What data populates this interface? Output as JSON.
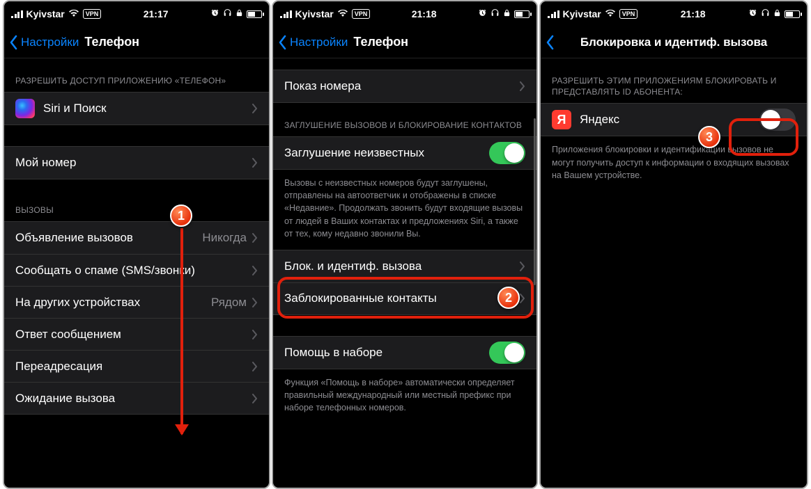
{
  "status": {
    "carrier": "Kyivstar",
    "vpn": "VPN",
    "times": {
      "s1": "21:17",
      "s2": "21:18",
      "s3": "21:18"
    }
  },
  "s1": {
    "back": "Настройки",
    "title": "Телефон",
    "sec_allow": "РАЗРЕШИТЬ ДОСТУП ПРИЛОЖЕНИЮ «ТЕЛЕФОН»",
    "siri": "Siri и Поиск",
    "my_number": "Мой номер",
    "sec_calls": "ВЫЗОВЫ",
    "announce": "Объявление вызовов",
    "announce_v": "Никогда",
    "spam": "Сообщать о спаме (SMS/звонки)",
    "other_dev": "На других устройствах",
    "other_dev_v": "Рядом",
    "reply_msg": "Ответ сообщением",
    "forward": "Переадресация",
    "waiting": "Ожидание вызова"
  },
  "s2": {
    "back": "Настройки",
    "title": "Телефон",
    "show_id": "Показ номера",
    "sec_sil": "ЗАГЛУШЕНИЕ ВЫЗОВОВ И БЛОКИРОВАНИЕ КОНТАКТОВ",
    "silence": "Заглушение неизвестных",
    "silence_foot": "Вызовы с неизвестных номеров будут заглушены, отправлены на автоответчик и отображены в списке «Недавние». Продолжать звонить будут входящие вызовы от людей в Ваших контактах и предложениях Siri, а также от тех, кому недавно звонили Вы.",
    "block_id": "Блок. и идентиф. вызова",
    "blocked": "Заблокированные контакты",
    "assist": "Помощь в наборе",
    "assist_foot": "Функция «Помощь в наборе» автоматически определяет правильный международный или местный префикс при наборе телефонных номеров."
  },
  "s3": {
    "title": "Блокировка и идентиф. вызова",
    "sec": "РАЗРЕШИТЬ ЭТИМ ПРИЛОЖЕНИЯМ БЛОКИРОВАТЬ И ПРЕДСТАВЛЯТЬ ID АБОНЕНТА:",
    "yandex": "Яндекс",
    "yandex_letter": "Я",
    "foot": "Приложения блокировки и идентификации вызовов не могут получить доступ к информации о входящих вызовах на Вашем устройстве."
  },
  "badges": {
    "b1": "1",
    "b2": "2",
    "b3": "3"
  }
}
